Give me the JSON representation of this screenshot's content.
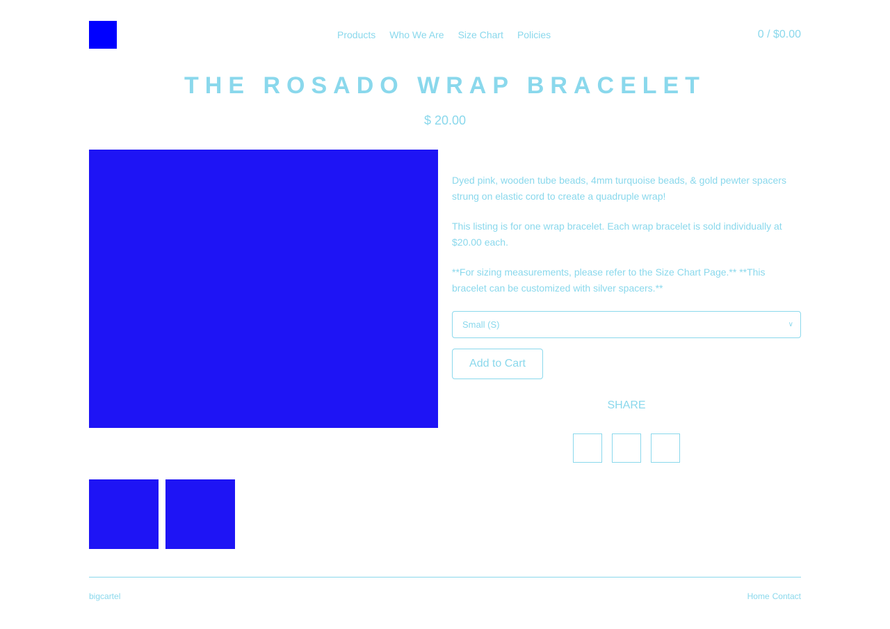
{
  "header": {
    "logo": "store-logo",
    "nav": [
      "Products",
      "Who We Are",
      "Size Chart",
      "Policies"
    ],
    "cart": "0 / $0.00"
  },
  "product": {
    "title": "THE ROSADO WRAP BRACELET",
    "price": "$ 20.00",
    "description": [
      "Dyed pink, wooden tube beads, 4mm turquoise beads, & gold pewter spacers strung on elastic cord to create a quadruple wrap!",
      "This listing is for one wrap bracelet. Each wrap bracelet is sold individually at $20.00 each.",
      "**For sizing measurements, please refer to the Size Chart Page.** **This bracelet can be customized with silver spacers.**"
    ],
    "size_select": "Small (S)",
    "add_to_cart": "Add to Cart",
    "share_label": "SHARE"
  },
  "footer": {
    "left": "bigcartel",
    "right": [
      "Home",
      "Contact"
    ]
  },
  "colors": {
    "accent": "#8ad8ec",
    "image_placeholder": "#1e14f5",
    "logo": "#0000ff"
  }
}
